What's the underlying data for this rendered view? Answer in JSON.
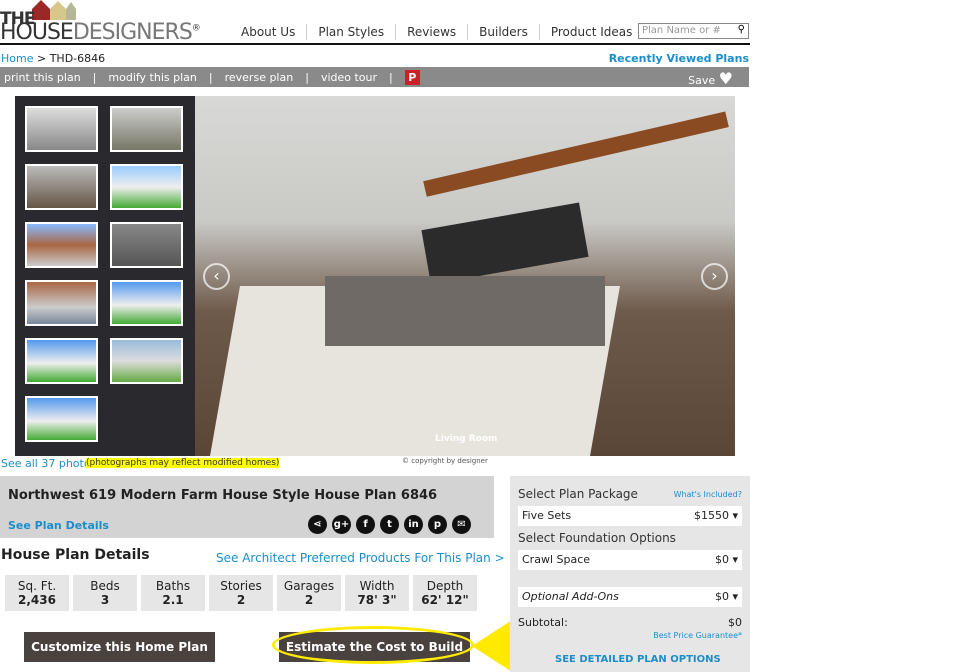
{
  "header": {
    "logo_the": "THE",
    "logo_house": "HOUSE",
    "logo_designers": "DESIGNERS",
    "logo_reg": "®",
    "nav": [
      "About Us",
      "Plan Styles",
      "Reviews",
      "Builders",
      "Product Ideas"
    ],
    "search_placeholder": "Plan Name or #"
  },
  "breadcrumb": {
    "home": "Home",
    "sep": " > ",
    "current": "THD-6846"
  },
  "recently_viewed": "Recently Viewed Plans",
  "toolbar": {
    "items": [
      "print this plan",
      "modify this plan",
      "reverse plan",
      "video tour"
    ],
    "sep": "|",
    "pinterest": "P",
    "save": "Save"
  },
  "gallery": {
    "caption": "Living Room",
    "see_all": "See all 37 photos",
    "note": "(photographs may reflect modified homes)",
    "copyright": "© copyright by designer",
    "prev": "‹",
    "next": "›"
  },
  "plan": {
    "title": "Northwest 619 Modern Farm House Style House Plan 6846",
    "see_details": "See Plan Details",
    "social": [
      "share",
      "g+",
      "f",
      "t",
      "in",
      "p",
      "✉"
    ]
  },
  "details": {
    "heading": "House Plan Details",
    "architect_link": "See Architect Preferred Products For This Plan >",
    "stats": [
      {
        "label": "Sq. Ft.",
        "value": "2,436"
      },
      {
        "label": "Beds",
        "value": "3"
      },
      {
        "label": "Baths",
        "value": "2.1"
      },
      {
        "label": "Stories",
        "value": "2"
      },
      {
        "label": "Garages",
        "value": "2"
      },
      {
        "label": "Width",
        "value": "78' 3\""
      },
      {
        "label": "Depth",
        "value": "62' 12\""
      }
    ]
  },
  "buttons": {
    "customize": "Customize this  Home Plan",
    "estimate": "Estimate the Cost to Build"
  },
  "panel": {
    "package_label": "Select Plan Package",
    "whats_included": "What's Included?",
    "package": "Five Sets",
    "package_price": "$1550 ▾",
    "foundation_label": "Select Foundation Options",
    "foundation": "Crawl Space",
    "foundation_price": "$0 ▾",
    "addons": "Optional Add-Ons",
    "addons_price": "$0 ▾",
    "subtotal_label": "Subtotal:",
    "subtotal": "$0",
    "guarantee": "Best Price Guarantee*",
    "detailed": "SEE DETAILED PLAN OPTIONS"
  },
  "colors": {
    "link": "#1b8ec9",
    "button": "#4a423e",
    "highlight": "#ffea00",
    "toolbar": "#8a8a8a"
  }
}
